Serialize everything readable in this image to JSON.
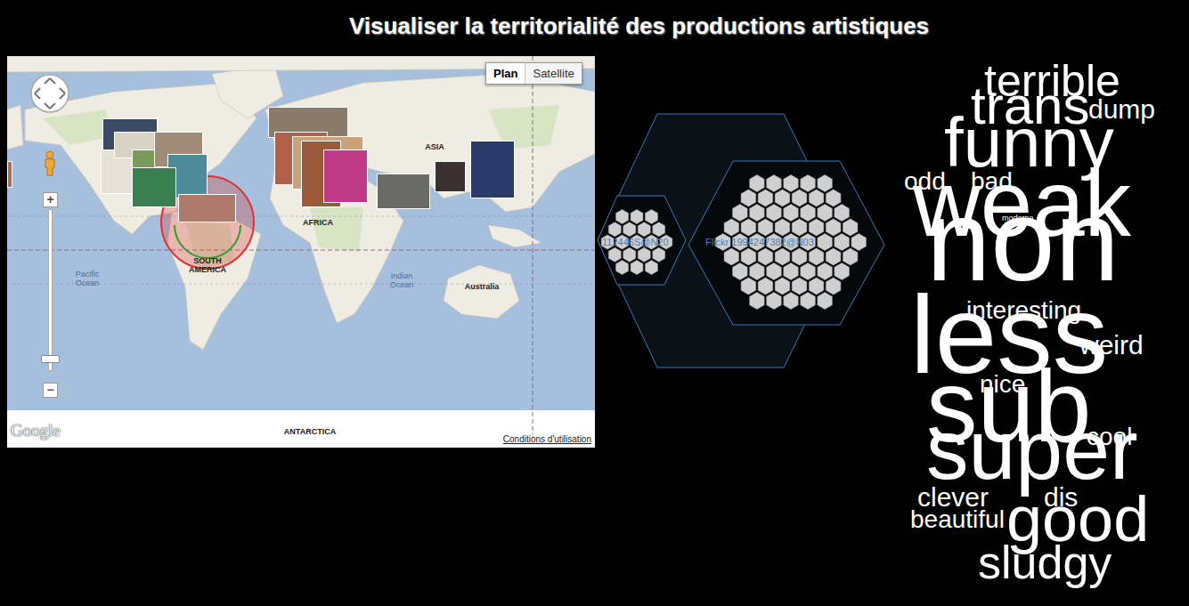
{
  "title": "Visualiser la territorialité des productions artistiques",
  "map": {
    "map_types": [
      {
        "label": "Plan",
        "selected": true
      },
      {
        "label": "Satellite",
        "selected": false
      }
    ],
    "zoom": {
      "in": "+",
      "out": "−",
      "level": 0.05
    },
    "labels": [
      {
        "text": "ASIA",
        "kind": "continent"
      },
      {
        "text": "AFRICA",
        "kind": "continent"
      },
      {
        "text": "SOUTH AMERICA",
        "kind": "continent"
      },
      {
        "text": "Pacific Ocean",
        "kind": "ocean"
      },
      {
        "text": "Indian Ocean",
        "kind": "ocean"
      },
      {
        "text": "Australia",
        "kind": "country"
      },
      {
        "text": "ANTARCTICA",
        "kind": "continent"
      }
    ],
    "logo": "Google",
    "terms": "Conditions d'utilisation"
  },
  "users": [
    {
      "label": "112446S@N20",
      "photos": 19
    },
    {
      "label": "Flickr 1994247382@N03",
      "photos": 61
    }
  ],
  "tags": [
    "terrible",
    "trans",
    "dump",
    "funny",
    "odd",
    "bad",
    "weak",
    "moderne",
    "non",
    "interesting",
    "less",
    "weird",
    "nice",
    "sub",
    "cool",
    "super",
    "clever",
    "dis",
    "beautiful",
    "good",
    "sludgy"
  ]
}
